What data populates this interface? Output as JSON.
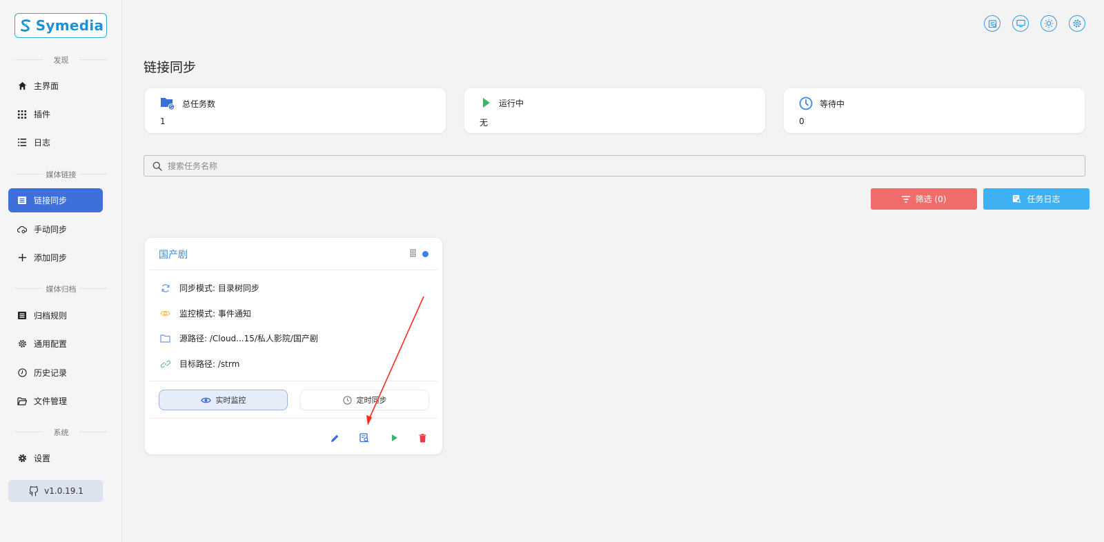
{
  "sidebar": {
    "brand": "Symedia",
    "sections": {
      "discover": "发现",
      "media_link": "媒体链接",
      "media_archive": "媒体归档",
      "system": "系统"
    },
    "items": {
      "home": "主界面",
      "plugins": "插件",
      "logs": "日志",
      "link_sync": "链接同步",
      "manual_sync": "手动同步",
      "add_sync": "添加同步",
      "archive_rules": "归档规则",
      "general_config": "通用配置",
      "history": "历史记录",
      "file_manager": "文件管理",
      "settings": "设置"
    },
    "version": "v1.0.19.1"
  },
  "page": {
    "title": "链接同步"
  },
  "stats": {
    "total": {
      "label": "总任务数",
      "value": "1"
    },
    "running": {
      "label": "运行中",
      "value": "无"
    },
    "waiting": {
      "label": "等待中",
      "value": "0"
    }
  },
  "search": {
    "placeholder": "搜索任务名称"
  },
  "actions": {
    "filter_label": "筛选 (0)",
    "task_log_label": "任务日志"
  },
  "task": {
    "name": "国产剧",
    "sync_mode": "同步模式: 目录树同步",
    "monitor_mode": "监控模式: 事件通知",
    "source_path": "源路径: /Cloud...15/私人影院/国产剧",
    "target_path": "目标路径: /strm",
    "realtime_label": "实时监控",
    "scheduled_label": "定时同步"
  },
  "colors": {
    "accent": "#3f6fd8",
    "filter": "#ef6d6a",
    "log": "#3fb0f2",
    "running": "#3bb56b",
    "delete": "#ee3b48"
  }
}
